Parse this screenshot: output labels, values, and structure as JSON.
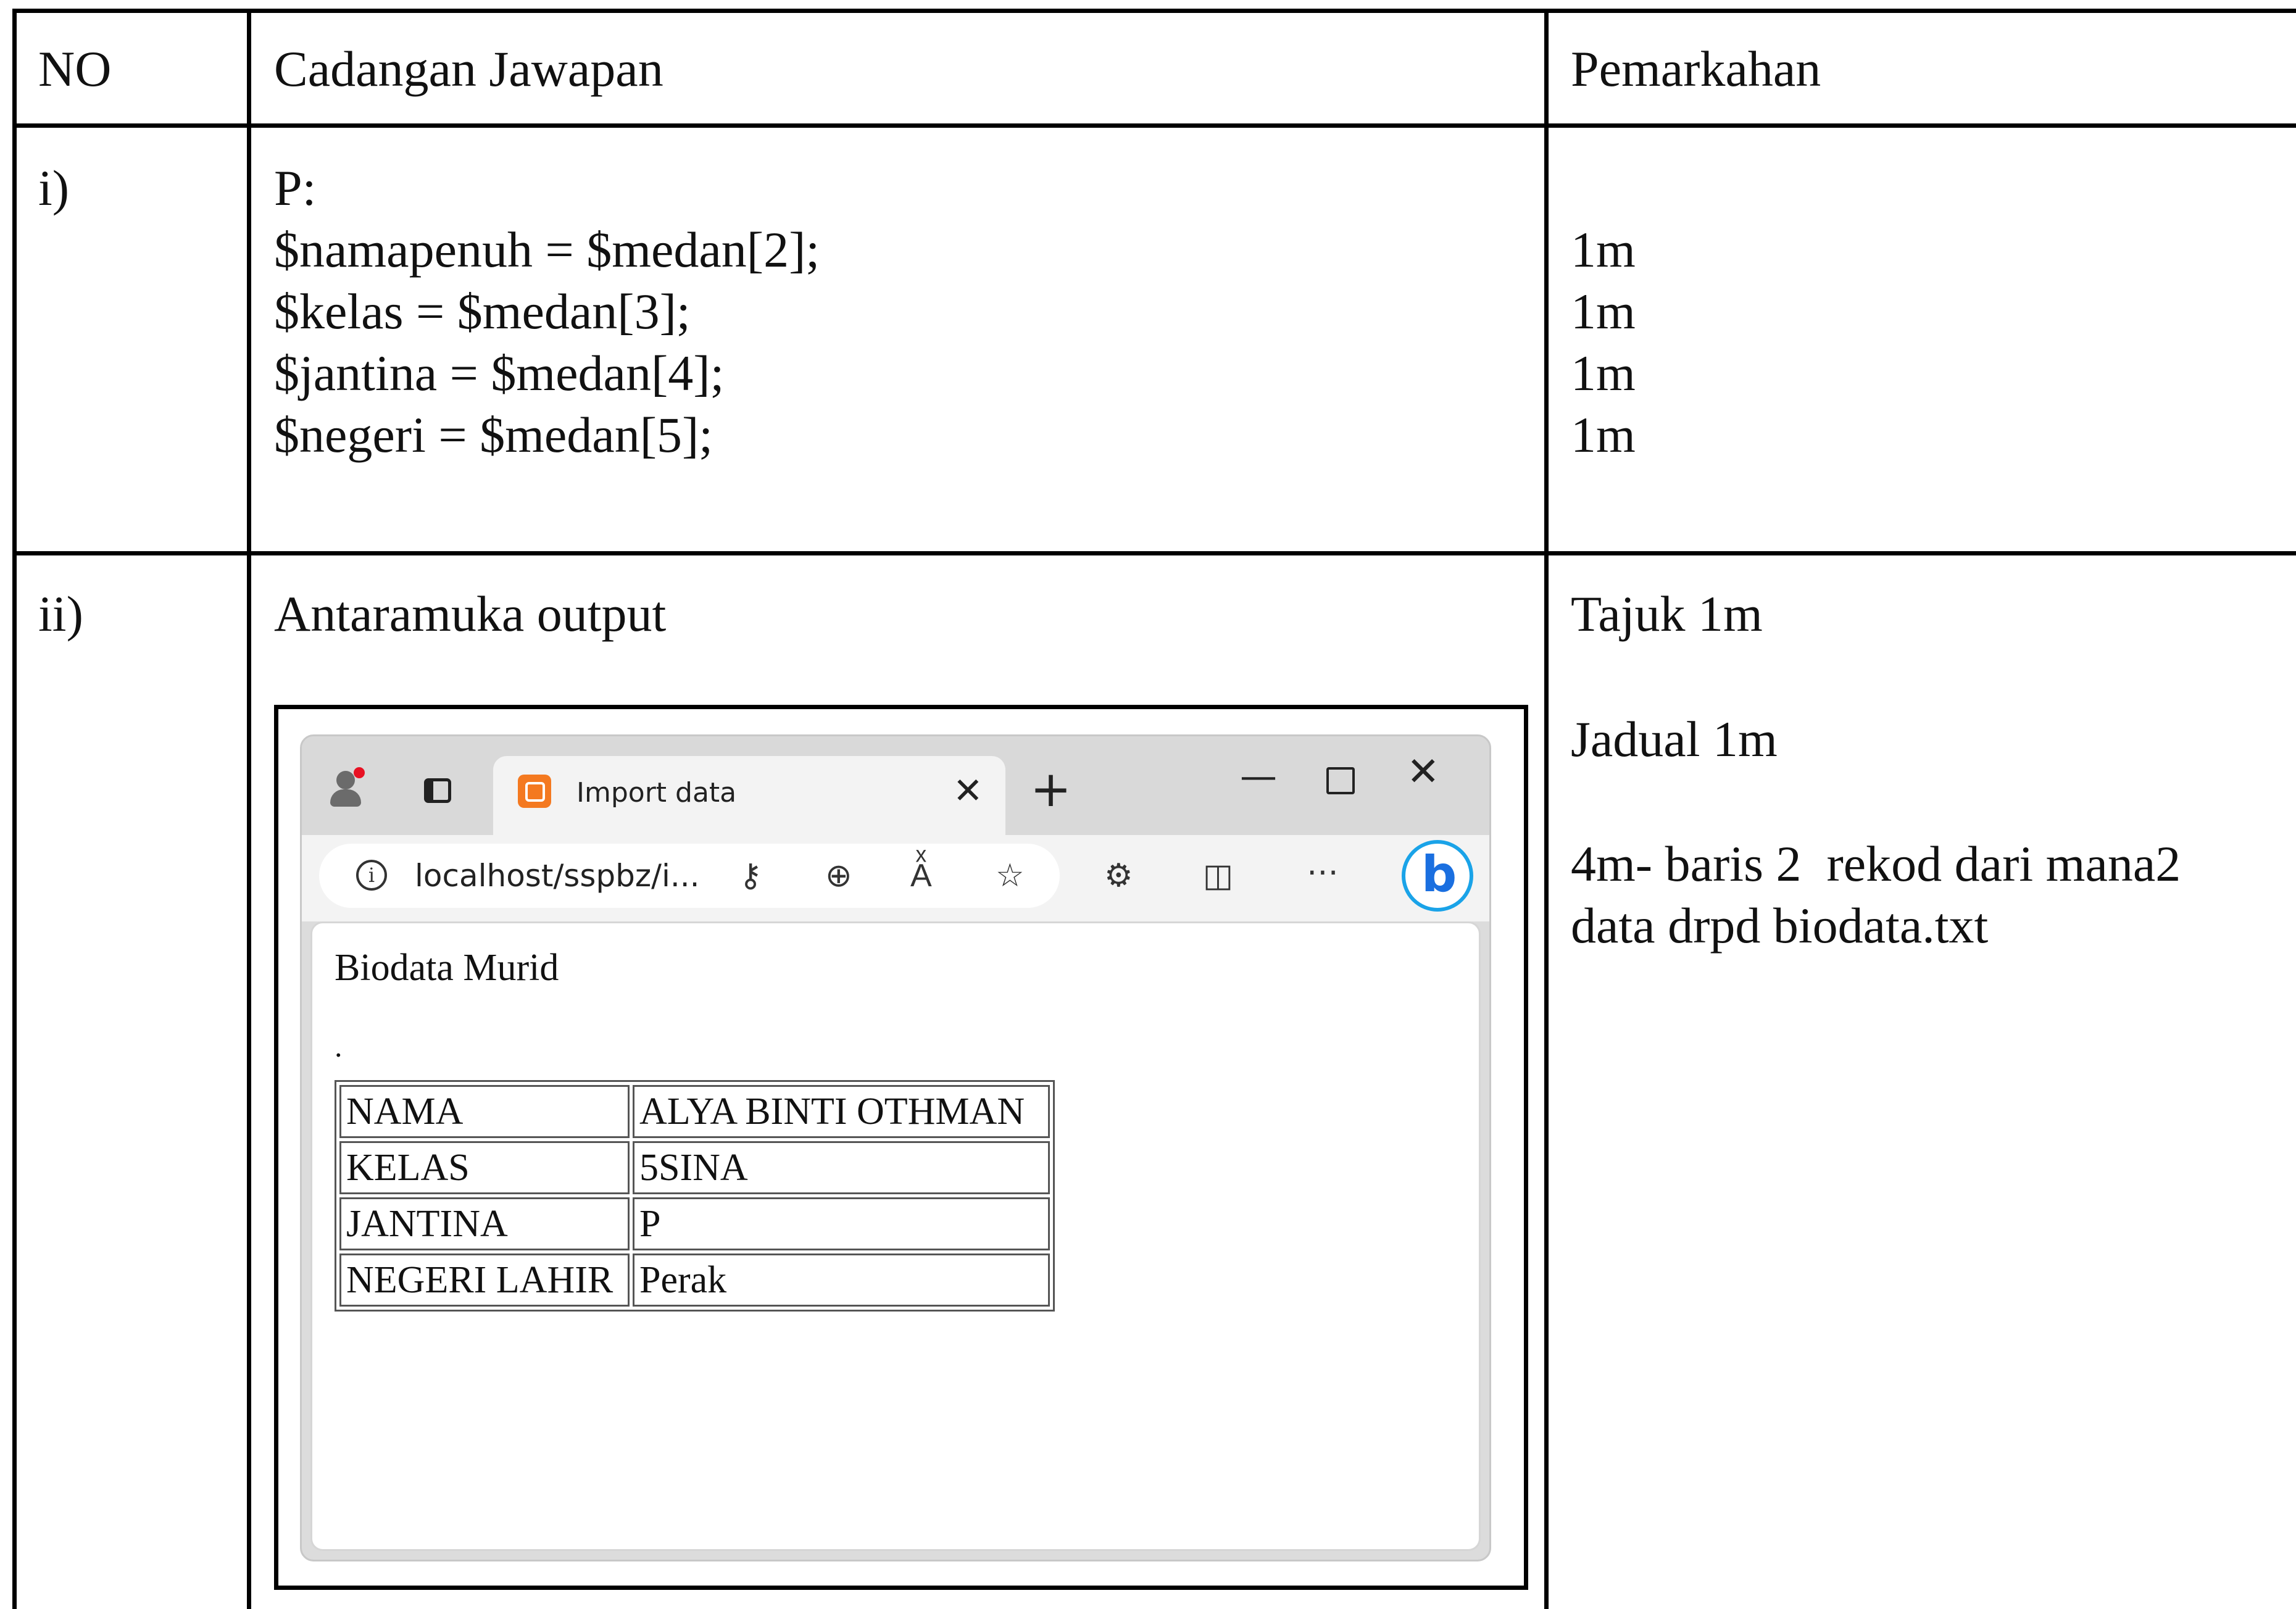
{
  "table": {
    "headers": [
      "NO",
      "Cadangan Jawapan",
      "Pemarkahan"
    ],
    "rows": [
      {
        "no": "i)",
        "answer_lines": [
          "P:",
          "$namapenuh = $medan[2];",
          "$kelas = $medan[3];",
          "$jantina = $medan[4];",
          "$negeri = $medan[5];"
        ],
        "marks_lines": [
          "1m",
          "1m",
          "1m",
          "1m"
        ]
      },
      {
        "no": "ii)",
        "answer_title": "Antaramuka output",
        "marks_lines": [
          "Tajuk 1m",
          "Jadual 1m",
          "4m- baris 2  rekod dari mana2",
          "data drpd biodata.txt"
        ]
      }
    ]
  },
  "browser": {
    "tab_title": "Import data",
    "tab_favicon": "xampp-icon",
    "url": "localhost/sspbz/i...",
    "page": {
      "heading": "Biodata Murid",
      "dot": ".",
      "rows": [
        {
          "label": "NAMA",
          "value": "ALYA BINTI OTHMAN"
        },
        {
          "label": "KELAS",
          "value": "5SINA"
        },
        {
          "label": "JANTINA",
          "value": "P"
        },
        {
          "label": "NEGERI LAHIR",
          "value": "Perak"
        }
      ]
    }
  }
}
